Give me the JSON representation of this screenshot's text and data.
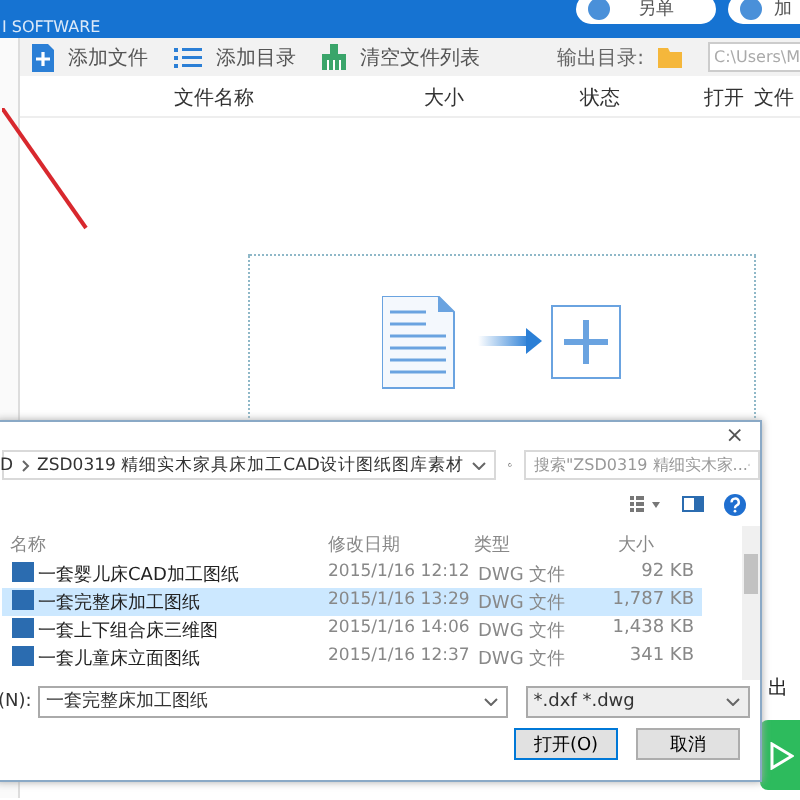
{
  "header": {
    "brand": "I SOFTWARE",
    "buttons": [
      "另单",
      "加"
    ]
  },
  "toolbar": {
    "items": [
      {
        "kind": "add-file",
        "label": "添加文件"
      },
      {
        "kind": "add-folder",
        "label": "添加目录"
      },
      {
        "kind": "clear",
        "label": "清空文件列表"
      }
    ],
    "output_label": "输出目录:",
    "output_path": "C:\\Users\\M"
  },
  "columns": [
    "文件名称",
    "大小",
    "状态",
    "打开",
    "文件"
  ],
  "dialog": {
    "close": "×",
    "path_root": "D",
    "path": "ZSD0319  精细实木家具床加工CAD设计图纸图库素材",
    "search_placeholder": "搜索\"ZSD0319  精细实木家...",
    "columns": [
      "名称",
      "修改日期",
      "类型",
      "大小"
    ],
    "rows": [
      {
        "name": "一套婴儿床CAD加工图纸",
        "date": "2015/1/16 12:12",
        "type": "DWG 文件",
        "size": "92 KB",
        "selected": false
      },
      {
        "name": "一套完整床加工图纸",
        "date": "2015/1/16 13:29",
        "type": "DWG 文件",
        "size": "1,787 KB",
        "selected": true
      },
      {
        "name": "一套上下组合床三维图",
        "date": "2015/1/16 14:06",
        "type": "DWG 文件",
        "size": "1,438 KB",
        "selected": false
      },
      {
        "name": "一套儿童床立面图纸",
        "date": "2015/1/16 12:37",
        "type": "DWG 文件",
        "size": "341 KB",
        "selected": false
      }
    ],
    "filename_label": "(N):",
    "filename": "一套完整床加工图纸",
    "filter": "*.dxf *.dwg",
    "open": "打开(O)",
    "cancel": "取消"
  },
  "side_text": "出"
}
